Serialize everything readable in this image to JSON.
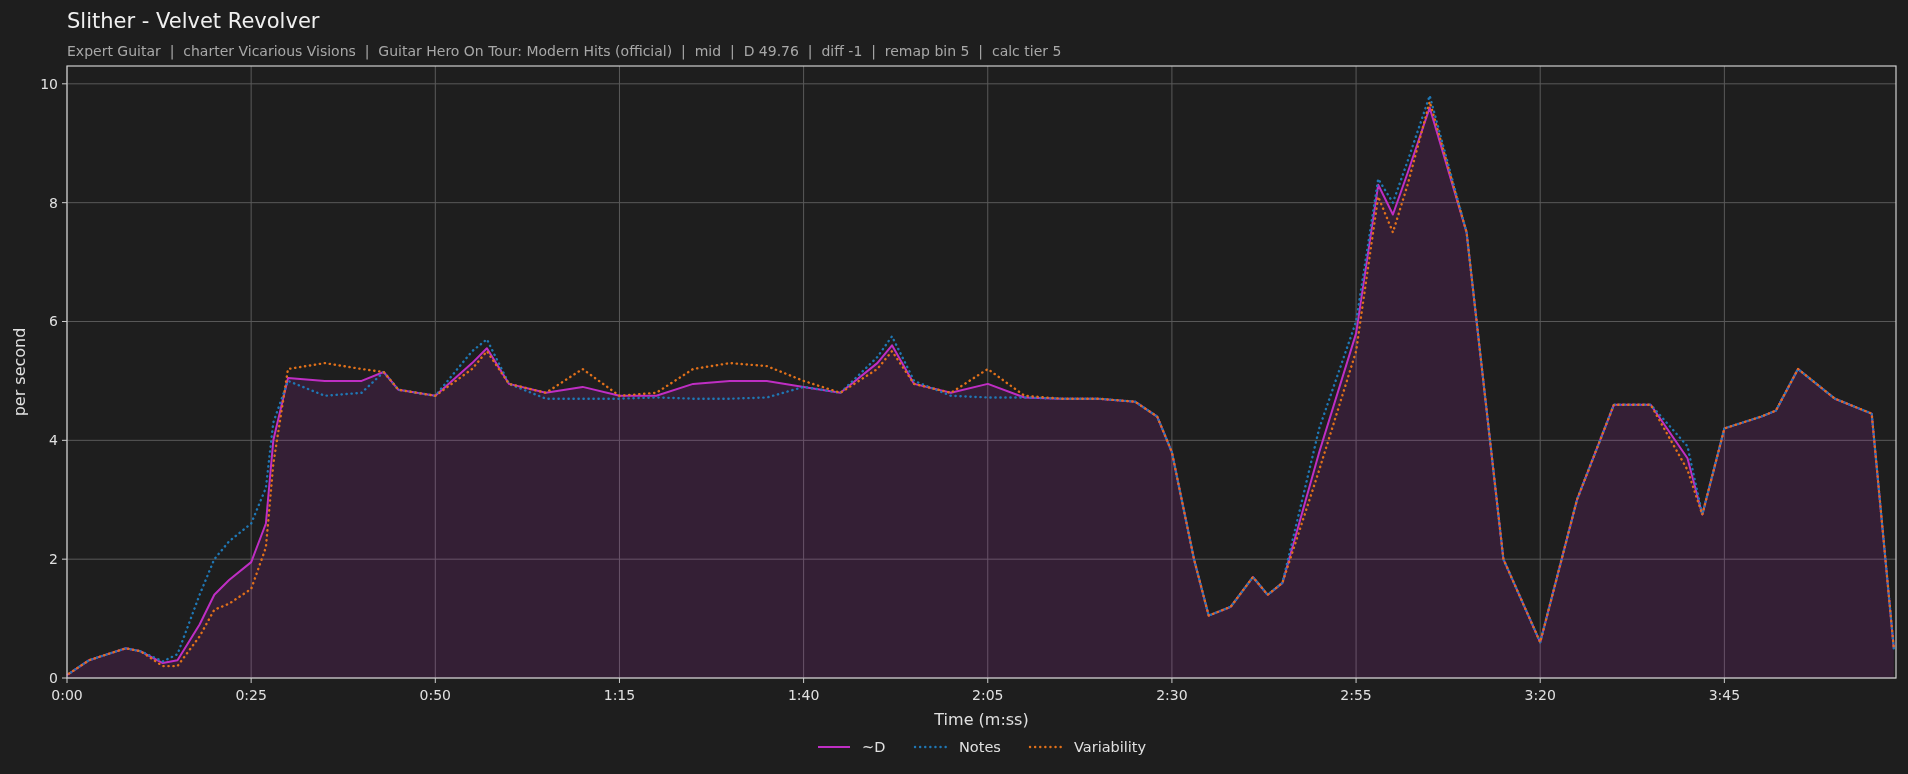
{
  "title": "Slither - Velvet Revolver",
  "subtitle": "Expert Guitar  |  charter Vicarious Visions  |  Guitar Hero On Tour: Modern Hits (official)  |  mid  |  D 49.76  |  diff -1  |  remap bin 5  |  calc tier 5",
  "chart_data": {
    "type": "line",
    "xlabel": "Time (m:ss)",
    "ylabel": "per second",
    "x": [
      0,
      3,
      5,
      8,
      10,
      13,
      15,
      18,
      20,
      22,
      25,
      27,
      28,
      30,
      35,
      40,
      43,
      45,
      50,
      55,
      57,
      60,
      65,
      70,
      75,
      80,
      85,
      90,
      95,
      100,
      105,
      110,
      112,
      115,
      120,
      125,
      130,
      135,
      140,
      145,
      148,
      150,
      153,
      155,
      158,
      161,
      163,
      165,
      170,
      175,
      178,
      180,
      182,
      185,
      190,
      195,
      200,
      205,
      210,
      215,
      220,
      222,
      225,
      230,
      232,
      235,
      240,
      245,
      248
    ],
    "series": [
      {
        "name": "~D",
        "color": "#bf2ec4",
        "type": "area",
        "line_style": "solid",
        "values": [
          0.05,
          0.3,
          0.38,
          0.5,
          0.45,
          0.25,
          0.3,
          0.9,
          1.4,
          1.65,
          1.95,
          2.6,
          4.0,
          5.05,
          5.0,
          5.0,
          5.15,
          4.85,
          4.75,
          5.3,
          5.55,
          4.95,
          4.8,
          4.9,
          4.75,
          4.75,
          4.95,
          5.0,
          5.0,
          4.9,
          4.8,
          5.3,
          5.6,
          4.95,
          4.8,
          4.95,
          4.72,
          4.7,
          4.7,
          4.65,
          4.4,
          3.8,
          2.0,
          1.05,
          1.2,
          1.7,
          1.4,
          1.6,
          3.8,
          5.8,
          8.3,
          7.8,
          8.5,
          9.6,
          7.5,
          2.0,
          0.6,
          3.0,
          4.6,
          4.6,
          3.7,
          2.75,
          4.2,
          4.4,
          4.5,
          5.2,
          4.7,
          4.45,
          0.5
        ]
      },
      {
        "name": "Notes",
        "color": "#1f77b4",
        "type": "line",
        "line_style": "dotted",
        "values": [
          0.05,
          0.3,
          0.38,
          0.5,
          0.45,
          0.28,
          0.4,
          1.4,
          2.0,
          2.3,
          2.6,
          3.2,
          4.3,
          5.0,
          4.75,
          4.8,
          5.15,
          4.85,
          4.75,
          5.5,
          5.7,
          4.95,
          4.7,
          4.7,
          4.7,
          4.72,
          4.7,
          4.7,
          4.72,
          4.9,
          4.8,
          5.4,
          5.75,
          5.0,
          4.75,
          4.72,
          4.72,
          4.7,
          4.7,
          4.65,
          4.4,
          3.8,
          2.0,
          1.05,
          1.2,
          1.7,
          1.4,
          1.6,
          4.2,
          6.0,
          8.4,
          8.0,
          8.7,
          9.8,
          7.5,
          2.0,
          0.6,
          3.0,
          4.6,
          4.6,
          3.9,
          2.75,
          4.2,
          4.4,
          4.5,
          5.2,
          4.7,
          4.45,
          0.5
        ]
      },
      {
        "name": "Variability",
        "color": "#e0701a",
        "type": "line",
        "line_style": "dotted",
        "values": [
          0.05,
          0.3,
          0.38,
          0.5,
          0.45,
          0.2,
          0.2,
          0.7,
          1.15,
          1.25,
          1.5,
          2.2,
          3.6,
          5.2,
          5.3,
          5.2,
          5.15,
          4.85,
          4.75,
          5.2,
          5.5,
          4.95,
          4.8,
          5.2,
          4.75,
          4.8,
          5.2,
          5.3,
          5.25,
          5.0,
          4.8,
          5.2,
          5.5,
          4.95,
          4.8,
          5.2,
          4.75,
          4.7,
          4.7,
          4.65,
          4.4,
          3.8,
          2.0,
          1.05,
          1.2,
          1.7,
          1.4,
          1.6,
          3.5,
          5.5,
          8.1,
          7.5,
          8.3,
          9.7,
          7.5,
          2.0,
          0.6,
          3.0,
          4.6,
          4.6,
          3.5,
          2.75,
          4.2,
          4.4,
          4.5,
          5.2,
          4.7,
          4.45,
          0.5
        ]
      }
    ],
    "grid": true,
    "legend": true,
    "xlim": [
      0,
      248.3
    ],
    "ylim": [
      0,
      10.3
    ],
    "xticks": [
      {
        "value": 0,
        "label": "0:00"
      },
      {
        "value": 25,
        "label": "0:25"
      },
      {
        "value": 50,
        "label": "0:50"
      },
      {
        "value": 75,
        "label": "1:15"
      },
      {
        "value": 100,
        "label": "1:40"
      },
      {
        "value": 125,
        "label": "2:05"
      },
      {
        "value": 150,
        "label": "2:30"
      },
      {
        "value": 175,
        "label": "2:55"
      },
      {
        "value": 200,
        "label": "3:20"
      },
      {
        "value": 225,
        "label": "3:45"
      }
    ],
    "yticks": [
      0,
      2,
      4,
      6,
      8,
      10
    ]
  }
}
